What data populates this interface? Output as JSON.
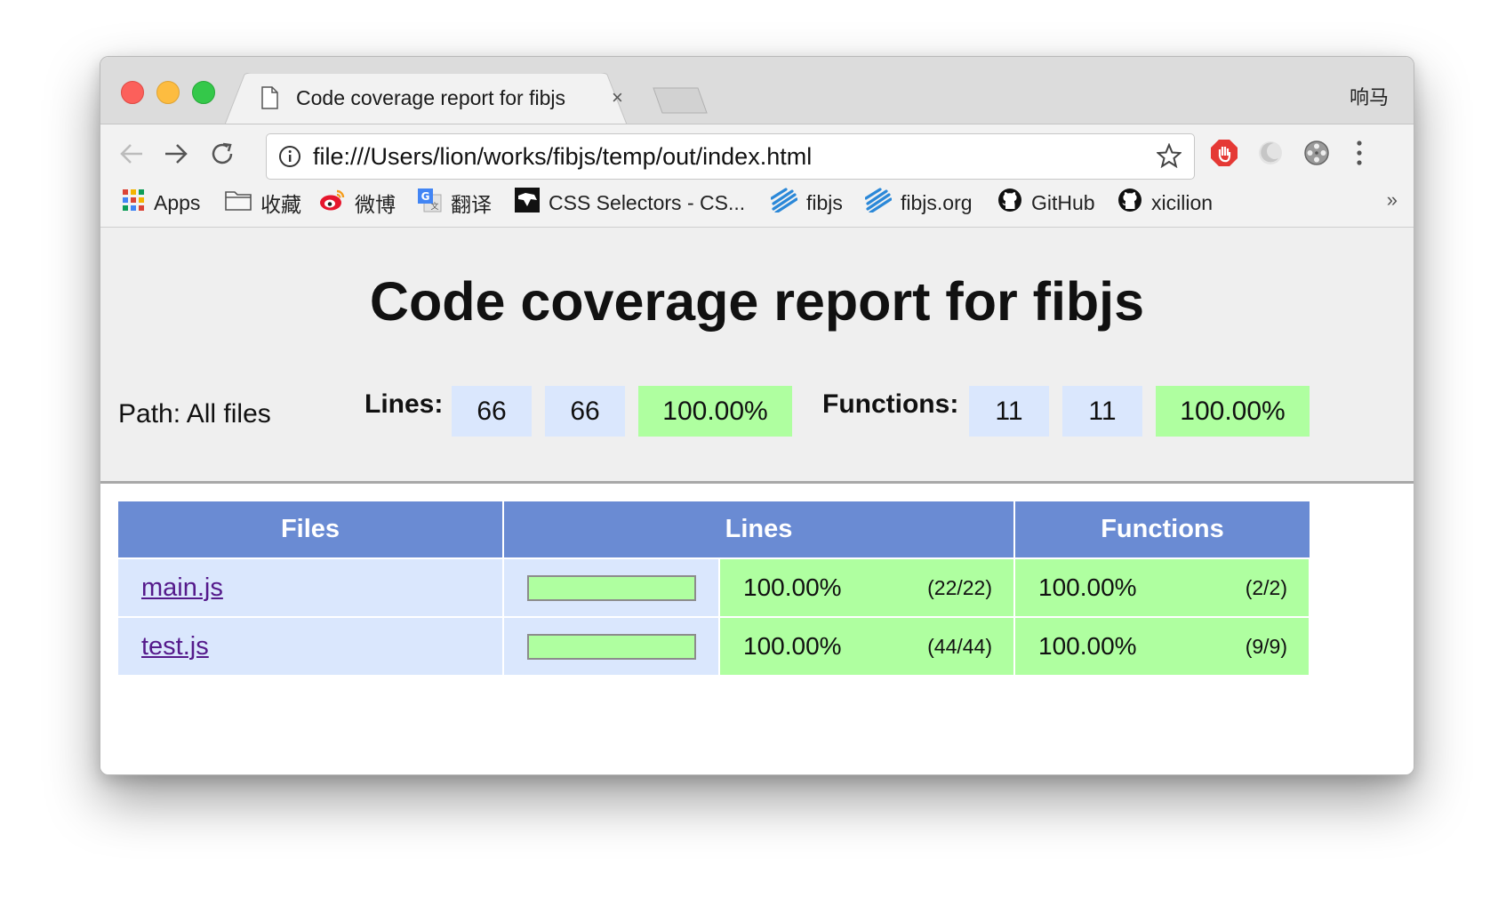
{
  "browser": {
    "tab_title": "Code coverage report for fibjs",
    "tab_close": "×",
    "profile_name": "响马",
    "url": "file:///Users/lion/works/fibjs/temp/out/index.html",
    "bookmarks": [
      {
        "label": "Apps",
        "icon": "apps-grid-icon"
      },
      {
        "label": "收藏",
        "icon": "folder-icon"
      },
      {
        "label": "微博",
        "icon": "weibo-icon"
      },
      {
        "label": "翻译",
        "icon": "translate-icon"
      },
      {
        "label": "CSS Selectors - CS...",
        "icon": "css-selectors-icon"
      },
      {
        "label": "fibjs",
        "icon": "fibjs-icon"
      },
      {
        "label": "fibjs.org",
        "icon": "fibjs-icon"
      },
      {
        "label": "GitHub",
        "icon": "github-icon"
      },
      {
        "label": "xicilion",
        "icon": "github-icon"
      }
    ],
    "bookmarks_more": "»"
  },
  "report": {
    "title": "Code coverage report for fibjs",
    "path": "Path: All files",
    "lines_label": "Lines:",
    "lines_hit": "66",
    "lines_total": "66",
    "lines_pct": "100.00%",
    "functions_label": "Functions:",
    "functions_hit": "11",
    "functions_total": "11",
    "functions_pct": "100.00%"
  },
  "table": {
    "headers": [
      "Files",
      "Lines",
      "Functions"
    ],
    "rows": [
      {
        "file": "main.js",
        "lines_fraction": 1.0,
        "lines_pct": "100.00%",
        "lines_count": "(22/22)",
        "functions_pct": "100.00%",
        "functions_count": "(2/2)"
      },
      {
        "file": "test.js",
        "lines_fraction": 1.0,
        "lines_pct": "100.00%",
        "lines_count": "(44/44)",
        "functions_pct": "100.00%",
        "functions_count": "(9/9)"
      }
    ]
  },
  "colors": {
    "header_blue": "#6a8bd3",
    "cell_blue": "#dae7fd",
    "coverage_green": "#afffa0",
    "link_purple": "#551a8b"
  }
}
